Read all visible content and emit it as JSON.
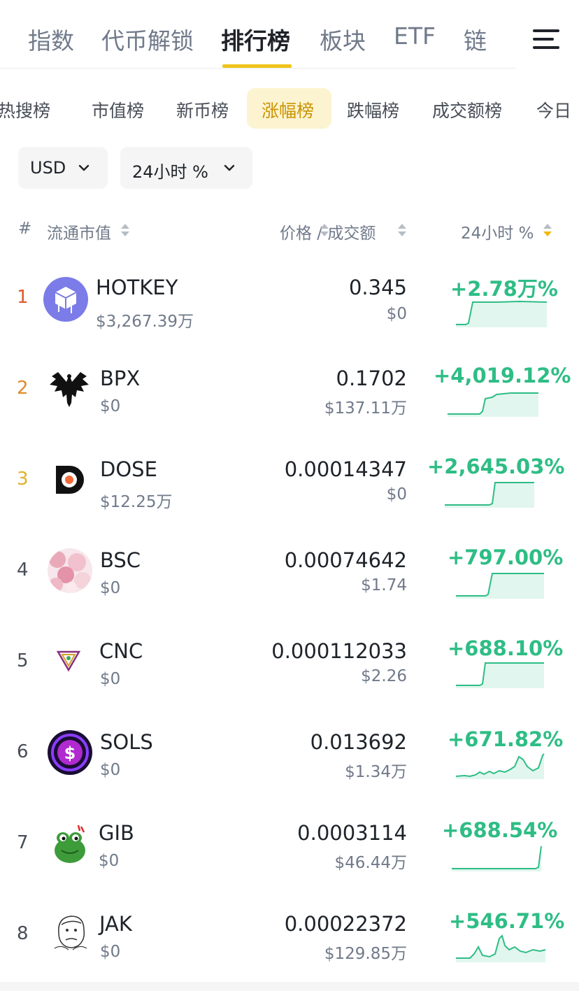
{
  "top_tabs": [
    "指数",
    "代币解锁",
    "排行榜",
    "板块",
    "ETF",
    "链"
  ],
  "sub_tabs": [
    "热搜榜",
    "市值榜",
    "新币榜",
    "涨幅榜",
    "跌幅榜",
    "成交额榜",
    "今日"
  ],
  "filters": {
    "currency": "USD",
    "period": "24小时 %"
  },
  "header": {
    "rank": "#",
    "market_cap": "流通市值",
    "price_volume": "价格 / 成交额",
    "change": "24小时 %"
  },
  "colors": {
    "accent": "#F0C419",
    "active_sub_tab": "#C99400",
    "positive": "#2EBD85",
    "rank1": "#E15A2B",
    "rank2": "#E08A2A",
    "rank3": "#E0B12A"
  },
  "rows": [
    {
      "rank": "1",
      "symbol": "HOTKEY",
      "mcap": "$3,267.39万",
      "price": "0.345",
      "volume": "$0",
      "change": "+2.78万%",
      "logo": "hotkey-logo"
    },
    {
      "rank": "2",
      "symbol": "BPX",
      "mcap": "$0",
      "price": "0.1702",
      "volume": "$137.11万",
      "change": "+4,019.12%",
      "logo": "bpx-phoenix-logo"
    },
    {
      "rank": "3",
      "symbol": "DOSE",
      "mcap": "$12.25万",
      "price": "0.00014347",
      "volume": "$0",
      "change": "+2,645.03%",
      "logo": "dose-logo"
    },
    {
      "rank": "4",
      "symbol": "BSC",
      "mcap": "$0",
      "price": "0.00074642",
      "volume": "$1.74",
      "change": "+797.00%",
      "logo": "bsc-logo"
    },
    {
      "rank": "5",
      "symbol": "CNC",
      "mcap": "$0",
      "price": "0.000112033",
      "volume": "$2.26",
      "change": "+688.10%",
      "logo": "cnc-logo"
    },
    {
      "rank": "6",
      "symbol": "SOLS",
      "mcap": "$0",
      "price": "0.013692",
      "volume": "$1.34万",
      "change": "+671.82%",
      "logo": "sols-logo"
    },
    {
      "rank": "7",
      "symbol": "GIB",
      "mcap": "$0",
      "price": "0.0003114",
      "volume": "$46.44万",
      "change": "+688.54%",
      "logo": "gib-frog-logo"
    },
    {
      "rank": "8",
      "symbol": "JAK",
      "mcap": "$0",
      "price": "0.00022372",
      "volume": "$129.85万",
      "change": "+546.71%",
      "logo": "jak-face-logo"
    }
  ]
}
